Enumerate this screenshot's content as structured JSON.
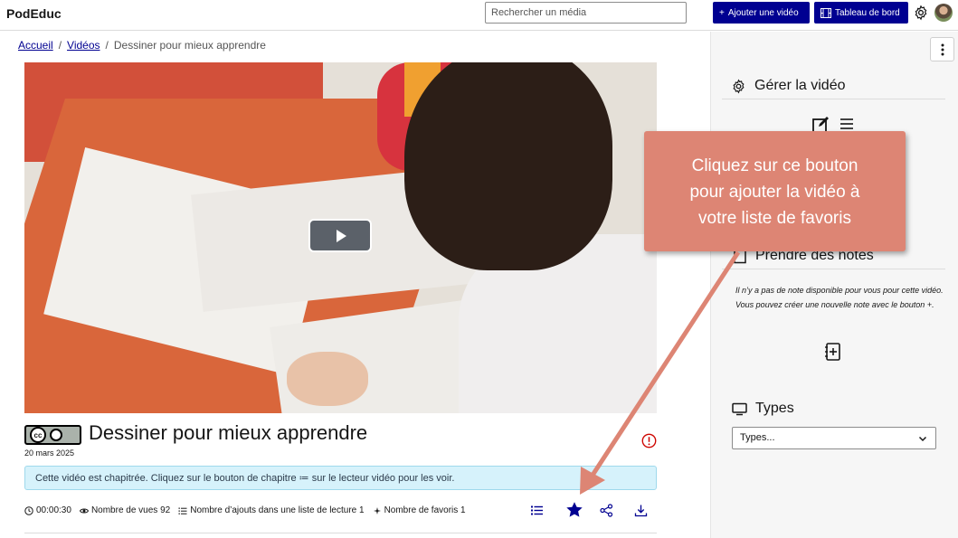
{
  "header": {
    "brand": "PodEduc",
    "search_placeholder": "Rechercher un média",
    "add_video_label": "Ajouter une vidéo",
    "dashboard_label": "Tableau de bord",
    "add_video_prefix": "+"
  },
  "breadcrumb": {
    "home": "Accueil",
    "sep": "/",
    "videos": "Vidéos",
    "current": "Dessiner pour mieux apprendre"
  },
  "video": {
    "title": "Dessiner pour mieux apprendre",
    "date": "20 mars 2025",
    "license_text": "cc"
  },
  "notice": {
    "text": "Cette vidéo est chapitrée. Cliquez sur le bouton de chapitre ≔ sur le lecteur vidéo pour les voir."
  },
  "meta": {
    "duration": "00:00:30",
    "views": "Nombre de vues 92",
    "playlists": "Nombre d’ajouts dans une liste de lecture 1",
    "favorites": "Nombre de favoris 1"
  },
  "sidebar": {
    "manage_title": "Gérer la vidéo",
    "notes_title": "Prendre des notes",
    "notes_empty_line1": "Il n’y a pas de note disponible pour vous pour cette vidéo.",
    "notes_empty_line2": "Vous pouvez créer une nouvelle note avec le bouton +.",
    "types_title": "Types",
    "types_select_value": "Types..."
  },
  "callout": {
    "line1": "Cliquez sur ce bouton",
    "line2": "pour ajouter la vidéo à",
    "line3": "votre liste de favoris"
  },
  "colors": {
    "primary": "#000091",
    "callout": "#dd8574",
    "notice_bg": "#d6f2fb",
    "report_red": "#ce0500"
  }
}
